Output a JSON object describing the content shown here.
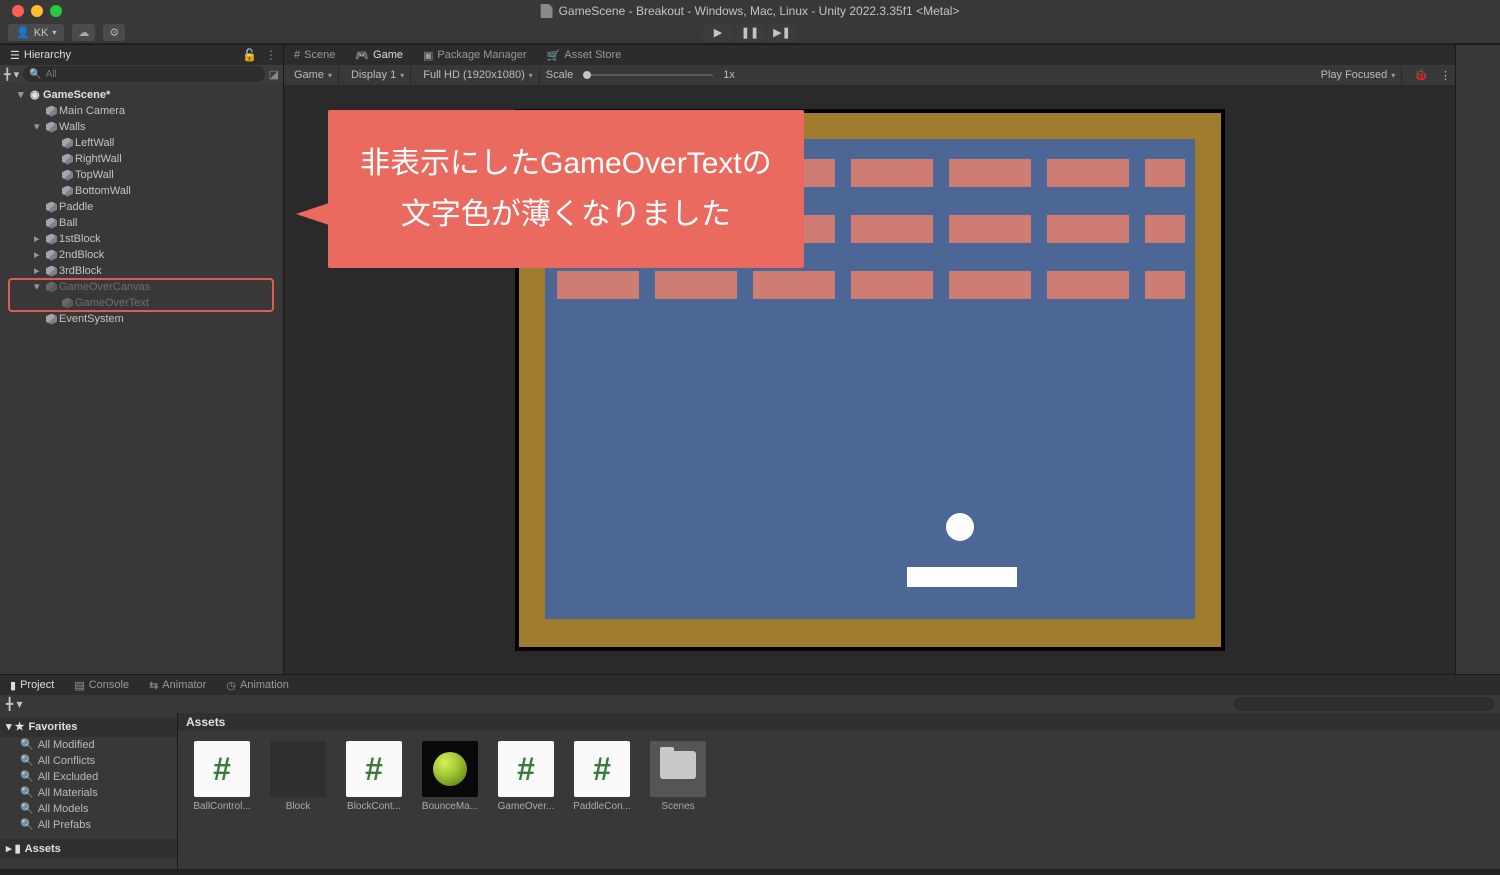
{
  "title": "GameScene - Breakout - Windows, Mac, Linux - Unity 2022.3.35f1 <Metal>",
  "user_menu": "KK",
  "hierarchy": {
    "tab": "Hierarchy",
    "search_placeholder": "All",
    "root": "GameScene*",
    "items": [
      "Main Camera",
      "Walls",
      "LeftWall",
      "RightWall",
      "TopWall",
      "BottomWall",
      "Paddle",
      "Ball",
      "1stBlock",
      "2ndBlock",
      "3rdBlock",
      "GameOverCanvas",
      "GameOverText",
      "EventSystem"
    ]
  },
  "tabs": {
    "scene": "Scene",
    "game": "Game",
    "pkg": "Package Manager",
    "store": "Asset Store"
  },
  "gametool": {
    "mode": "Game",
    "display": "Display 1",
    "res": "Full HD (1920x1080)",
    "scale": "Scale",
    "scaleval": "1x",
    "focus": "Play Focused"
  },
  "callout": {
    "l1": "非表示にしたGameOverTextの",
    "l2": "文字色が薄くなりました"
  },
  "project": {
    "tabs": [
      "Project",
      "Console",
      "Animator",
      "Animation"
    ],
    "fav_header": "Favorites",
    "favs": [
      "All Modified",
      "All Conflicts",
      "All Excluded",
      "All Materials",
      "All Models",
      "All Prefabs"
    ],
    "assets_header": "Assets",
    "assets": [
      {
        "name": "BallControl...",
        "type": "script"
      },
      {
        "name": "Block",
        "type": "block"
      },
      {
        "name": "BlockCont...",
        "type": "script"
      },
      {
        "name": "BounceMa...",
        "type": "mat"
      },
      {
        "name": "GameOver...",
        "type": "script"
      },
      {
        "name": "PaddleCon...",
        "type": "script"
      },
      {
        "name": "Scenes",
        "type": "folder"
      }
    ]
  }
}
